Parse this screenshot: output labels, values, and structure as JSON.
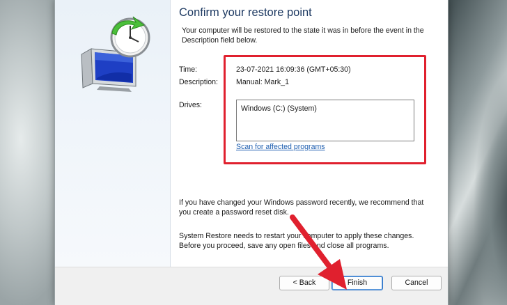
{
  "dialog": {
    "title": "Confirm your restore point",
    "intro": "Your computer will be restored to the state it was in before the event in the Description field below.",
    "fields": {
      "time_label": "Time:",
      "time_value": "23-07-2021 16:09:36 (GMT+05:30)",
      "description_label": "Description:",
      "description_value": "Manual: Mark_1",
      "drives_label": "Drives:",
      "drives_items": [
        "Windows (C:) (System)"
      ]
    },
    "scan_link": "Scan for affected programs",
    "password_note": "If you have changed your Windows password recently, we recommend that you create a password reset disk.",
    "restart_note": "System Restore needs to restart your computer to apply these changes. Before you proceed, save any open files and close all programs.",
    "buttons": {
      "back": "< Back",
      "finish": "Finish",
      "cancel": "Cancel"
    }
  },
  "icons": {
    "restore": "system-restore-icon",
    "pointer": "red-pointer-arrow-icon"
  },
  "colors": {
    "highlight": "#e0202e",
    "title": "#1e3a62",
    "link": "#1f5fb0",
    "arrow": "#e0202e"
  }
}
